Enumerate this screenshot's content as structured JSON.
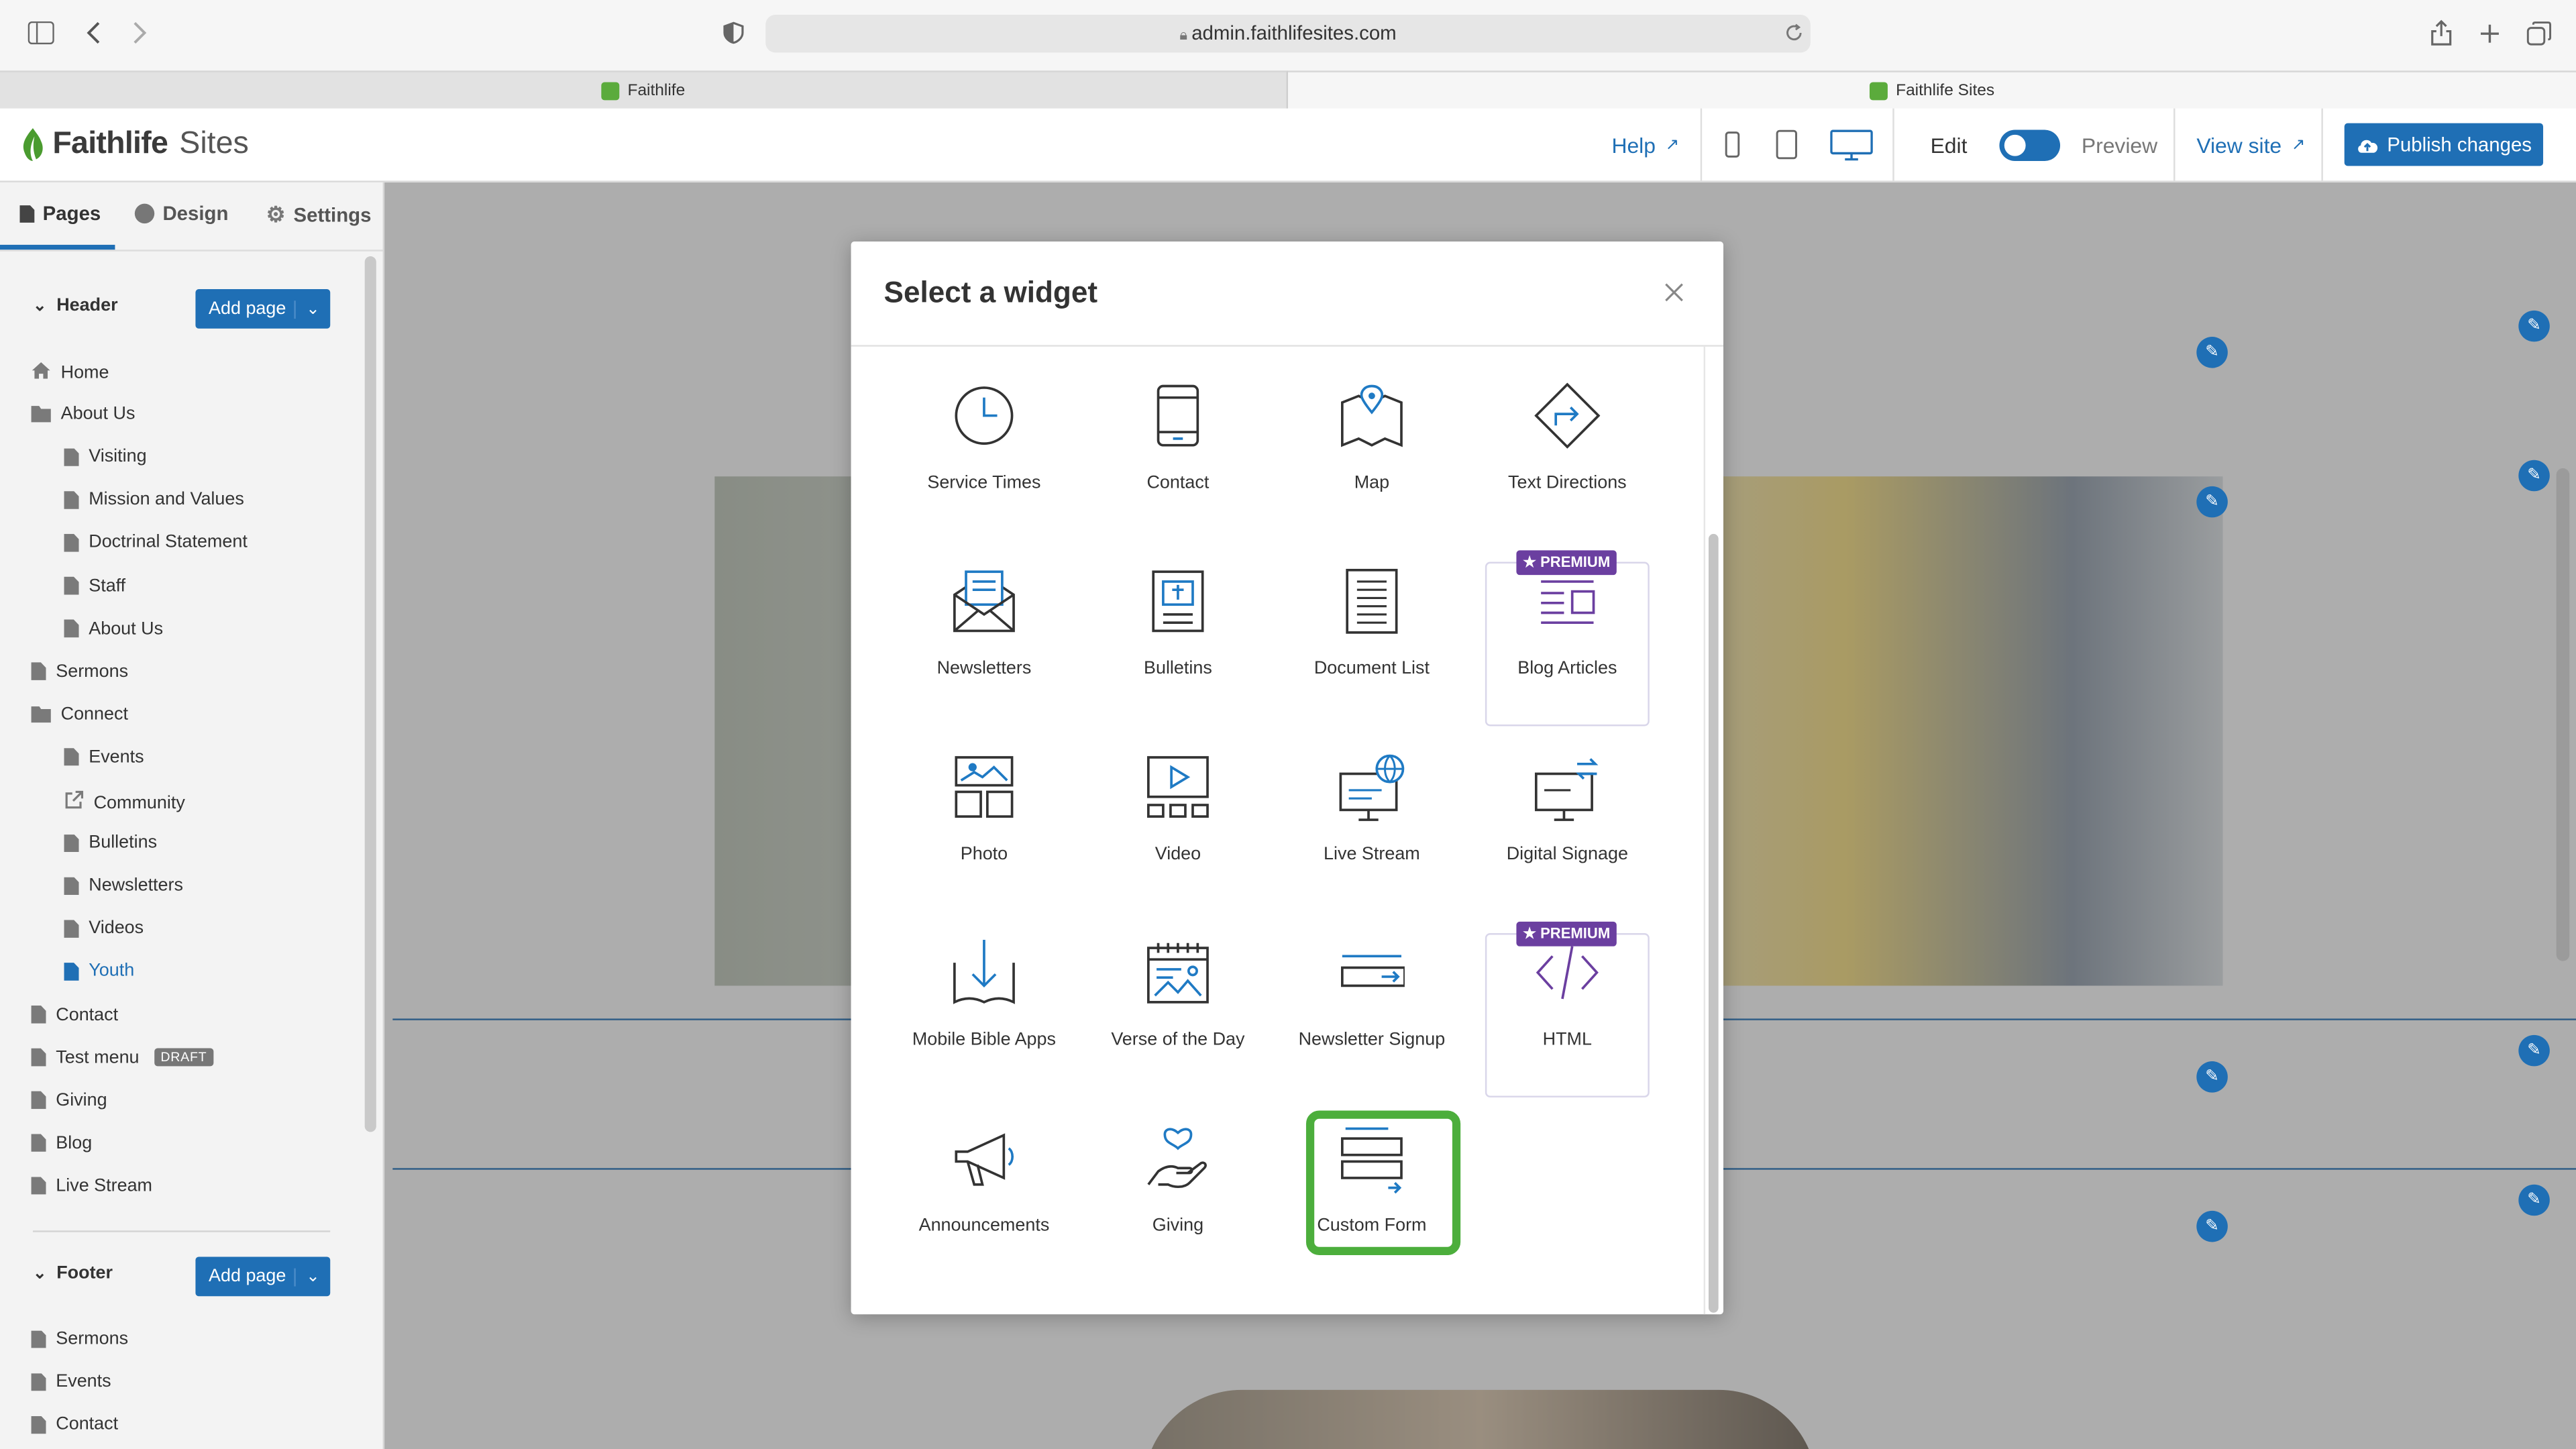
{
  "browser": {
    "url": "admin.faithlifesites.com",
    "tabs": [
      "Faithlife",
      "Faithlife Sites"
    ]
  },
  "app": {
    "brand_main": "Faithlife",
    "brand_sub": "Sites",
    "help": "Help",
    "edit": "Edit",
    "preview": "Preview",
    "view_site": "View site",
    "publish": "Publish changes",
    "accent": "#1f6fb5"
  },
  "sidebar": {
    "tabs": [
      "Pages",
      "Design",
      "Settings"
    ],
    "header_section": "Header",
    "footer_section": "Footer",
    "add_page": "Add page",
    "draft": "DRAFT",
    "header_items": [
      {
        "label": "Home",
        "type": "home",
        "indent": 0
      },
      {
        "label": "About Us",
        "type": "folder",
        "indent": 0
      },
      {
        "label": "Visiting",
        "type": "doc",
        "indent": 1
      },
      {
        "label": "Mission and Values",
        "type": "doc",
        "indent": 1
      },
      {
        "label": "Doctrinal Statement",
        "type": "doc",
        "indent": 1
      },
      {
        "label": "Staff",
        "type": "doc",
        "indent": 1
      },
      {
        "label": "About Us",
        "type": "doc",
        "indent": 1
      },
      {
        "label": "Sermons",
        "type": "doc",
        "indent": 0
      },
      {
        "label": "Connect",
        "type": "folder",
        "indent": 0
      },
      {
        "label": "Events",
        "type": "doc",
        "indent": 1
      },
      {
        "label": "Community",
        "type": "link",
        "indent": 1
      },
      {
        "label": "Bulletins",
        "type": "doc",
        "indent": 1
      },
      {
        "label": "Newsletters",
        "type": "doc",
        "indent": 1
      },
      {
        "label": "Videos",
        "type": "doc",
        "indent": 1
      },
      {
        "label": "Youth",
        "type": "doc",
        "indent": 1,
        "active": true
      },
      {
        "label": "Contact",
        "type": "doc",
        "indent": 0
      },
      {
        "label": "Test menu",
        "type": "doc",
        "indent": 0,
        "draft": true
      },
      {
        "label": "Giving",
        "type": "doc",
        "indent": 0
      },
      {
        "label": "Blog",
        "type": "doc",
        "indent": 0
      },
      {
        "label": "Live Stream",
        "type": "doc",
        "indent": 0
      }
    ],
    "footer_items": [
      {
        "label": "Sermons",
        "type": "doc",
        "indent": 0
      },
      {
        "label": "Events",
        "type": "doc",
        "indent": 0
      },
      {
        "label": "Contact",
        "type": "doc",
        "indent": 0
      }
    ]
  },
  "modal": {
    "title": "Select a widget",
    "premium_label": "★ PREMIUM",
    "widgets": [
      {
        "label": "Service Times",
        "icon": "clock-icon"
      },
      {
        "label": "Contact",
        "icon": "phone-icon"
      },
      {
        "label": "Map",
        "icon": "map-icon"
      },
      {
        "label": "Text Directions",
        "icon": "directions-icon"
      },
      {
        "label": "Newsletters",
        "icon": "envelope-icon"
      },
      {
        "label": "Bulletins",
        "icon": "bulletin-icon"
      },
      {
        "label": "Document List",
        "icon": "document-icon"
      },
      {
        "label": "Blog Articles",
        "icon": "blog-icon",
        "premium": true
      },
      {
        "label": "Photo",
        "icon": "photo-icon"
      },
      {
        "label": "Video",
        "icon": "video-icon"
      },
      {
        "label": "Live Stream",
        "icon": "live-stream-icon"
      },
      {
        "label": "Digital Signage",
        "icon": "signage-icon"
      },
      {
        "label": "Mobile Bible Apps",
        "icon": "bible-download-icon"
      },
      {
        "label": "Verse of the Day",
        "icon": "calendar-icon"
      },
      {
        "label": "Newsletter Signup",
        "icon": "signup-icon"
      },
      {
        "label": "HTML",
        "icon": "code-icon",
        "premium": true
      },
      {
        "label": "Announcements",
        "icon": "megaphone-icon"
      },
      {
        "label": "Giving",
        "icon": "giving-icon"
      },
      {
        "label": "Custom Form",
        "icon": "form-icon",
        "highlighted": true
      }
    ]
  }
}
